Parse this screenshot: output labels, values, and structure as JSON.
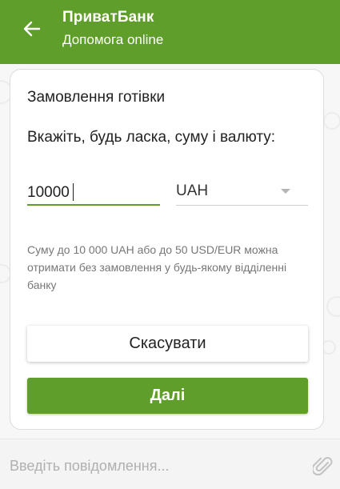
{
  "header": {
    "title": "ПриватБанк",
    "subtitle": "Допомога online"
  },
  "card": {
    "title": "Замовлення готівки",
    "instruction": "Вкажіть, будь ласка, суму і валюту:",
    "amount_value": "10000",
    "currency_value": "UAH",
    "note": "Суму до 10 000 UAH або до 50 USD/EUR можна отримати без замовлення у будь-якому відділенні банку",
    "cancel_label": "Скасувати",
    "next_label": "Далі"
  },
  "input_bar": {
    "placeholder": "Введіть повідомлення..."
  },
  "colors": {
    "brand_green": "#5f9e2b",
    "background": "#f7f7f7"
  },
  "icons": {
    "back": "arrow-left-icon",
    "attach": "paperclip-icon",
    "dropdown": "chevron-down-icon"
  }
}
